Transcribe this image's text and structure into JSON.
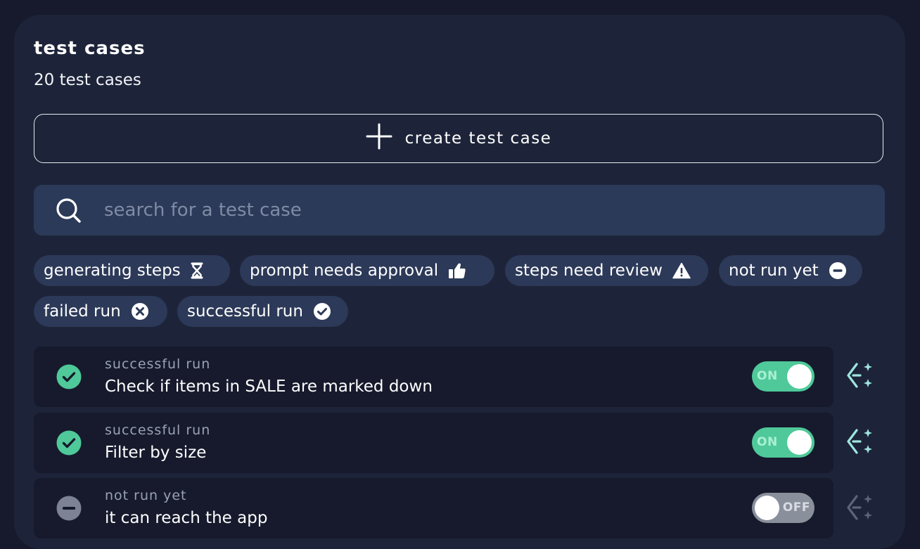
{
  "header": {
    "title": "test cases",
    "count_label": "20 test cases"
  },
  "create_button": {
    "label": "create test case",
    "icon": "plus-icon"
  },
  "search": {
    "placeholder": "search for a test case",
    "value": "",
    "icon": "search-icon"
  },
  "filters": [
    {
      "label": "generating steps",
      "icon": "hourglass-icon"
    },
    {
      "label": "prompt needs approval",
      "icon": "thumbs-up-icon"
    },
    {
      "label": "steps need review",
      "icon": "warning-icon"
    },
    {
      "label": "not run yet",
      "icon": "minus-circle-icon"
    },
    {
      "label": "failed run",
      "icon": "x-circle-icon"
    },
    {
      "label": "successful run",
      "icon": "check-circle-icon"
    }
  ],
  "test_cases": [
    {
      "status": "successful run",
      "name": "Check if items in SALE are marked down",
      "toggle": "ON",
      "enabled": true,
      "status_color": "#4fc99a"
    },
    {
      "status": "successful run",
      "name": "Filter by size",
      "toggle": "ON",
      "enabled": true,
      "status_color": "#4fc99a"
    },
    {
      "status": "not run yet",
      "name": "it can reach the app",
      "toggle": "OFF",
      "enabled": false,
      "status_color": "#7d8294"
    }
  ],
  "colors": {
    "background": "#161a2c",
    "panel": "#1d2439",
    "chip": "#2c3958",
    "search": "#2b3a58",
    "success": "#4fc99a",
    "ai_icon_active": "#9fe6e0",
    "ai_icon_inactive": "#5d6478"
  }
}
